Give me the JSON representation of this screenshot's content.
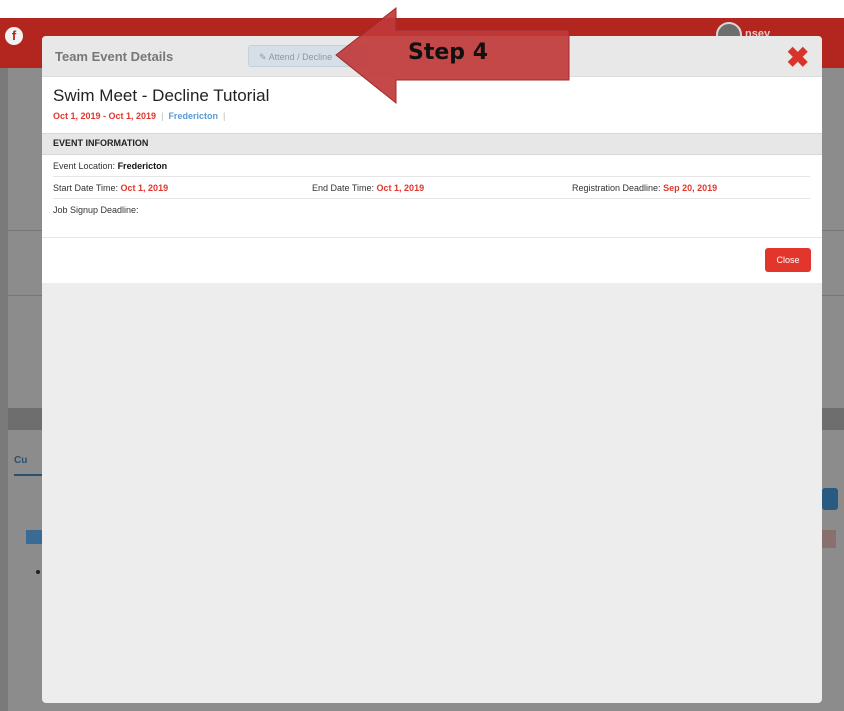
{
  "background": {
    "user_name": "nsey",
    "tab_label": "Cu"
  },
  "modal": {
    "title": "Team Event Details",
    "attend_button": "Attend / Decline",
    "event": {
      "name": "Swim Meet - Decline Tutorial",
      "date_range": "Oct 1, 2019 - Oct 1, 2019",
      "location_link": "Fredericton"
    },
    "section_title": "EVENT INFORMATION",
    "location_label": "Event Location:",
    "location_value": "Fredericton",
    "start_label": "Start Date Time:",
    "start_value": "Oct 1, 2019",
    "end_label": "End Date Time:",
    "end_value": "Oct 1, 2019",
    "reg_label": "Registration Deadline:",
    "reg_value": "Sep 20, 2019",
    "job_label": "Job Signup Deadline:",
    "close_button": "Close"
  },
  "annotation": {
    "step_label": "Step 4"
  },
  "colors": {
    "header_red": "#b3261f",
    "accent_red": "#e2362c",
    "link_blue": "#5b9bd6",
    "annotation_arrow": "#c0393a"
  }
}
